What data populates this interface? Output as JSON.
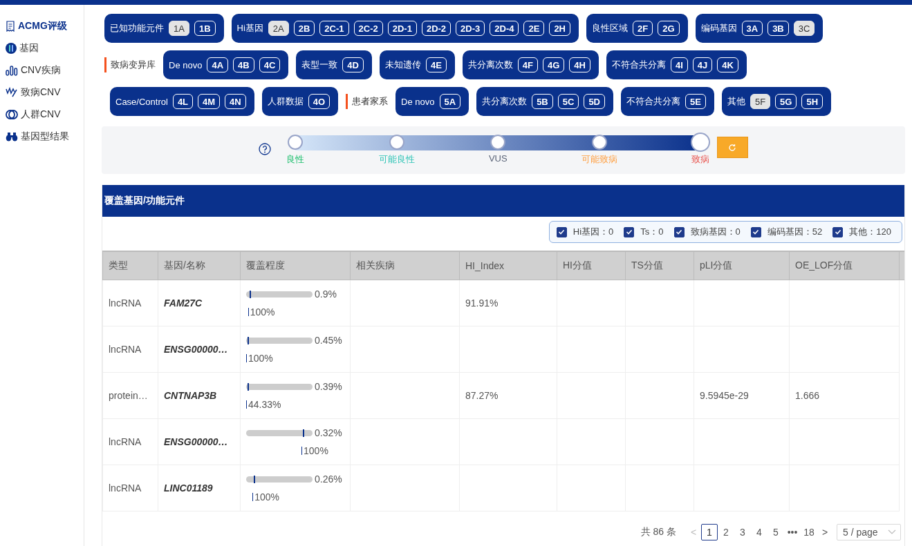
{
  "sidebar": {
    "items": [
      {
        "label": "ACMG评级",
        "selected": true
      },
      {
        "label": "基因",
        "selected": false
      },
      {
        "label": "CNV疾病",
        "selected": false
      },
      {
        "label": "致病CNV",
        "selected": false
      },
      {
        "label": "人群CNV",
        "selected": false
      },
      {
        "label": "基因型结果",
        "selected": false
      }
    ]
  },
  "criteria": {
    "rows": [
      {
        "items": [
          {
            "kind": "group",
            "label": "已知功能元件",
            "codes": [
              {
                "code": "1A",
                "selected": true
              },
              {
                "code": "1B",
                "selected": false
              }
            ]
          },
          {
            "kind": "group",
            "label": "Hi基因",
            "codes": [
              {
                "code": "2A",
                "selected": true
              },
              {
                "code": "2B",
                "selected": false
              },
              {
                "code": "2C-1",
                "selected": false
              },
              {
                "code": "2C-2",
                "selected": false
              },
              {
                "code": "2D-1",
                "selected": false
              },
              {
                "code": "2D-2",
                "selected": false
              },
              {
                "code": "2D-3",
                "selected": false
              },
              {
                "code": "2D-4",
                "selected": false
              },
              {
                "code": "2E",
                "selected": false
              },
              {
                "code": "2H",
                "selected": false
              }
            ]
          },
          {
            "kind": "group",
            "label": "良性区域",
            "codes": [
              {
                "code": "2F",
                "selected": false
              },
              {
                "code": "2G",
                "selected": false
              }
            ]
          },
          {
            "kind": "group",
            "label": "编码基因",
            "codes": [
              {
                "code": "3A",
                "selected": false
              },
              {
                "code": "3B",
                "selected": false
              },
              {
                "code": "3C",
                "selected": true
              }
            ]
          }
        ]
      },
      {
        "items": [
          {
            "kind": "section",
            "label": "致病变异库"
          },
          {
            "kind": "group",
            "label": "De novo",
            "codes": [
              {
                "code": "4A",
                "selected": false
              },
              {
                "code": "4B",
                "selected": false
              },
              {
                "code": "4C",
                "selected": false
              }
            ]
          },
          {
            "kind": "group",
            "label": "表型一致",
            "codes": [
              {
                "code": "4D",
                "selected": false
              }
            ]
          },
          {
            "kind": "group",
            "label": "未知遗传",
            "codes": [
              {
                "code": "4E",
                "selected": false
              }
            ]
          },
          {
            "kind": "group",
            "label": "共分离次数",
            "codes": [
              {
                "code": "4F",
                "selected": false
              },
              {
                "code": "4G",
                "selected": false
              },
              {
                "code": "4H",
                "selected": false
              }
            ]
          },
          {
            "kind": "group",
            "label": "不符合共分离",
            "codes": [
              {
                "code": "4I",
                "selected": false
              },
              {
                "code": "4J",
                "selected": false
              },
              {
                "code": "4K",
                "selected": false
              }
            ]
          }
        ]
      },
      {
        "items": [
          {
            "kind": "group",
            "label": "Case/Control",
            "codes": [
              {
                "code": "4L",
                "selected": false
              },
              {
                "code": "4M",
                "selected": false
              },
              {
                "code": "4N",
                "selected": false
              }
            ]
          },
          {
            "kind": "group",
            "label": "人群数据",
            "codes": [
              {
                "code": "4O",
                "selected": false
              }
            ]
          },
          {
            "kind": "section",
            "label": "患者家系"
          },
          {
            "kind": "group",
            "label": "De novo",
            "codes": [
              {
                "code": "5A",
                "selected": false
              }
            ]
          },
          {
            "kind": "group",
            "label": "共分离次数",
            "codes": [
              {
                "code": "5B",
                "selected": false
              },
              {
                "code": "5C",
                "selected": false
              },
              {
                "code": "5D",
                "selected": false
              }
            ]
          },
          {
            "kind": "group",
            "label": "不符合共分离",
            "codes": [
              {
                "code": "5E",
                "selected": false
              }
            ]
          },
          {
            "kind": "group",
            "label": "其他",
            "codes": [
              {
                "code": "5F",
                "selected": true
              },
              {
                "code": "5G",
                "selected": false
              },
              {
                "code": "5H",
                "selected": false
              }
            ]
          }
        ]
      }
    ]
  },
  "scale": {
    "stops": [
      {
        "label": "良性",
        "color": "#19be6b",
        "selected": false
      },
      {
        "label": "可能良性",
        "color": "#2ec4b6",
        "selected": false
      },
      {
        "label": "VUS",
        "color": "#5a6478",
        "selected": false
      },
      {
        "label": "可能致病",
        "color": "#ff9f40",
        "selected": false
      },
      {
        "label": "致病",
        "color": "#e8504a",
        "selected": true
      }
    ]
  },
  "panel": {
    "title": "覆盖基因/功能元件",
    "filters": [
      {
        "label": "Hi基因：0",
        "checked": true
      },
      {
        "label": "Ts：0",
        "checked": true
      },
      {
        "label": "致病基因：0",
        "checked": true
      },
      {
        "label": "编码基因：52",
        "checked": true
      },
      {
        "label": "其他：120",
        "checked": true
      }
    ],
    "table": {
      "columns": [
        "类型",
        "基因/名称",
        "覆盖程度",
        "相关疾病",
        "HI_Index",
        "HI分值",
        "TS分值",
        "pLI分值",
        "OE_LOF分值"
      ],
      "rows": [
        {
          "type": "lncRNA",
          "name": "FAM27C",
          "coverage": {
            "level": 0.03,
            "percent": "0.9%",
            "gene_percent": "100%"
          },
          "disease": "",
          "hi_index": "91.91%",
          "hi_score": "",
          "ts_score": "",
          "pli": "",
          "oe_lof": ""
        },
        {
          "type": "lncRNA",
          "name": "ENSG00000…",
          "coverage": {
            "level": 0.0,
            "percent": "0.45%",
            "gene_percent": "100%"
          },
          "disease": "",
          "hi_index": "",
          "hi_score": "",
          "ts_score": "",
          "pli": "",
          "oe_lof": ""
        },
        {
          "type": "protein…",
          "name": "CNTNAP3B",
          "coverage": {
            "level": 0.0,
            "percent": "0.39%",
            "gene_percent": "44.33%"
          },
          "disease": "",
          "hi_index": "87.27%",
          "hi_score": "",
          "ts_score": "",
          "pli": "9.5945e-29",
          "oe_lof": "1.666"
        },
        {
          "type": "lncRNA",
          "name": "ENSG00000…",
          "coverage": {
            "level": 0.87,
            "percent": "0.32%",
            "gene_percent": "100%"
          },
          "disease": "",
          "hi_index": "",
          "hi_score": "",
          "ts_score": "",
          "pli": "",
          "oe_lof": ""
        },
        {
          "type": "lncRNA",
          "name": "LINC01189",
          "coverage": {
            "level": 0.1,
            "percent": "0.26%",
            "gene_percent": "100%"
          },
          "disease": "",
          "hi_index": "",
          "hi_score": "",
          "ts_score": "",
          "pli": "",
          "oe_lof": ""
        }
      ]
    },
    "pagination": {
      "total": "共 86 条",
      "prev": "<",
      "pages": [
        {
          "label": "1",
          "selected": true
        },
        {
          "label": "2",
          "selected": false
        },
        {
          "label": "3",
          "selected": false
        },
        {
          "label": "4",
          "selected": false
        },
        {
          "label": "5",
          "selected": false
        },
        {
          "label": "•••",
          "selected": false
        },
        {
          "label": "18",
          "selected": false
        }
      ],
      "next": ">",
      "page_size": "5 / page"
    }
  }
}
